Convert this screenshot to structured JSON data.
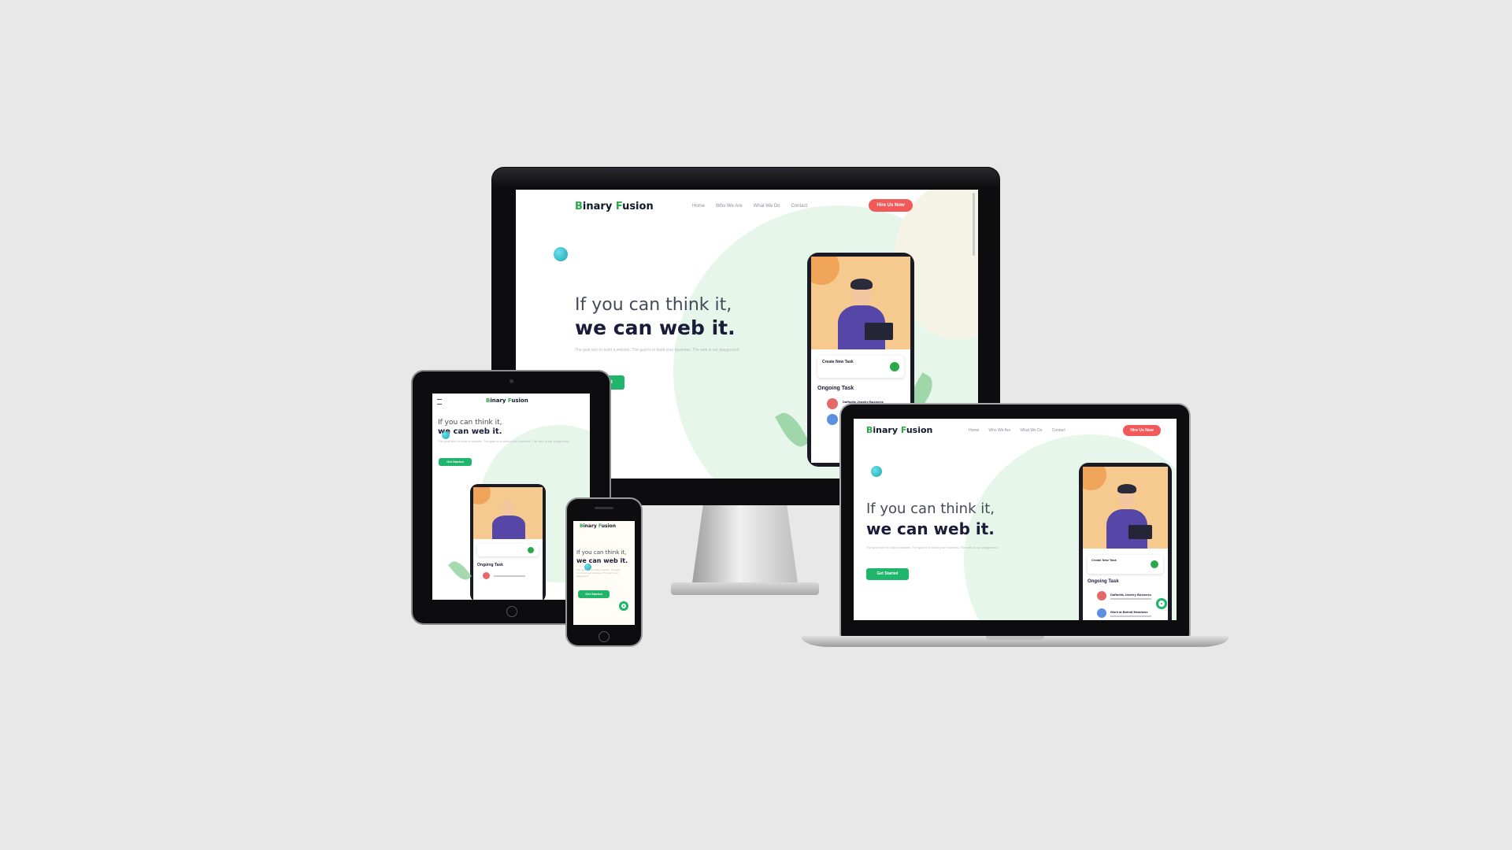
{
  "site": {
    "logo_first": "Binary ",
    "logo_b": "B",
    "logo_rest_first": "inary ",
    "logo_f": "F",
    "logo_rest_second": "usion",
    "nav": [
      "Home",
      "Who We Are",
      "What We Do",
      "Contact"
    ],
    "cta": "Hire Us Now",
    "headline_line1": "If you can think it,",
    "headline_line2": "we can web it.",
    "tagline": "The goal isn't to build a website. The goal is to build your business. The web is our playground.",
    "button": "Get Started",
    "mockup": {
      "card_title": "Create New Task",
      "task_heading": "Ongoing Task",
      "task_rows": [
        "Daffodils Jewelry Business",
        "Work at Bofold Meadows"
      ]
    }
  },
  "colors": {
    "background": "#e8e8e8",
    "brand_green": "#2aa84a",
    "cta_red": "#f25a5a",
    "button_green": "#1fb56b",
    "heading_dark": "#1b1b3a"
  }
}
